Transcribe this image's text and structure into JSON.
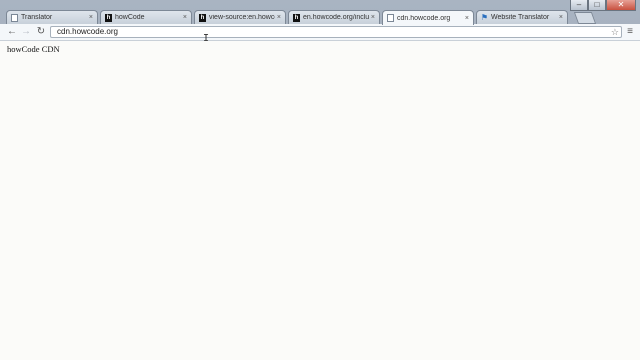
{
  "tabs": [
    {
      "label": "Translator",
      "favicon": "page-icon",
      "close": "×",
      "active": false
    },
    {
      "label": "howCode",
      "favicon": "howcode-icon",
      "favicon_glyph": "h",
      "close": "×",
      "active": false
    },
    {
      "label": "view-source:en.howcode.org",
      "favicon": "howcode-icon",
      "favicon_glyph": "h",
      "close": "×",
      "active": false
    },
    {
      "label": "en.howcode.org/include",
      "favicon": "howcode-icon",
      "favicon_glyph": "h",
      "close": "×",
      "active": false
    },
    {
      "label": "cdn.howcode.org",
      "favicon": "page-icon",
      "close": "×",
      "active": true
    },
    {
      "label": "Website Translator",
      "favicon": "website-translator-icon",
      "favicon_glyph": "⚑",
      "close": "×",
      "active": false
    }
  ],
  "toolbar": {
    "back_icon": "←",
    "forward_icon": "→",
    "reload_icon": "↻",
    "menu_icon": "≡",
    "star_icon": "☆"
  },
  "omnibox": {
    "url": "cdn.howcode.org"
  },
  "window": {
    "minimize": "–",
    "maximize": "□",
    "close": "✕"
  },
  "page": {
    "body_text": "howCode CDN"
  },
  "cursor": {
    "glyph": "I"
  },
  "colors": {
    "page_background": "#fbfbf9",
    "frame": "#a9b4c2"
  }
}
